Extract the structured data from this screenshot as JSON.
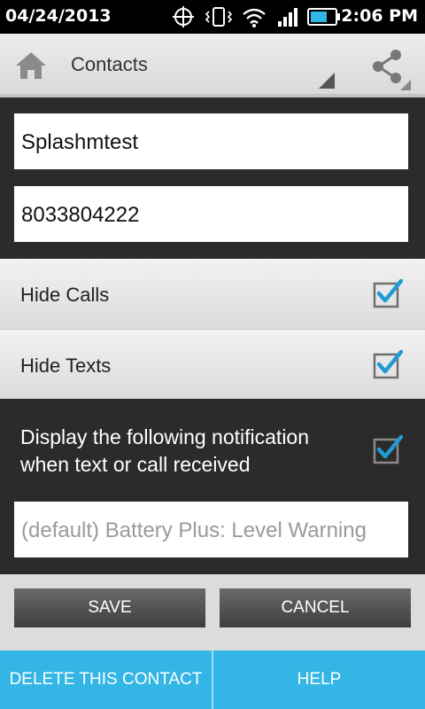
{
  "status_bar": {
    "date": "04/24/2013",
    "time": "2:06 PM"
  },
  "action_bar": {
    "title": "Contacts"
  },
  "contact": {
    "name": "Splashmtest",
    "phone": "8033804222"
  },
  "options": {
    "hide_calls": {
      "label": "Hide Calls",
      "checked": true
    },
    "hide_texts": {
      "label": "Hide Texts",
      "checked": true
    },
    "notification": {
      "label": "Display the following notification when text or call received",
      "checked": true,
      "value": "(default) Battery Plus: Level Warning"
    }
  },
  "buttons": {
    "save": "SAVE",
    "cancel": "CANCEL"
  },
  "footer": {
    "delete": "DELETE THIS CONTACT",
    "help": "HELP"
  },
  "colors": {
    "accent": "#33b5e5",
    "check": "#1e9bd7"
  }
}
